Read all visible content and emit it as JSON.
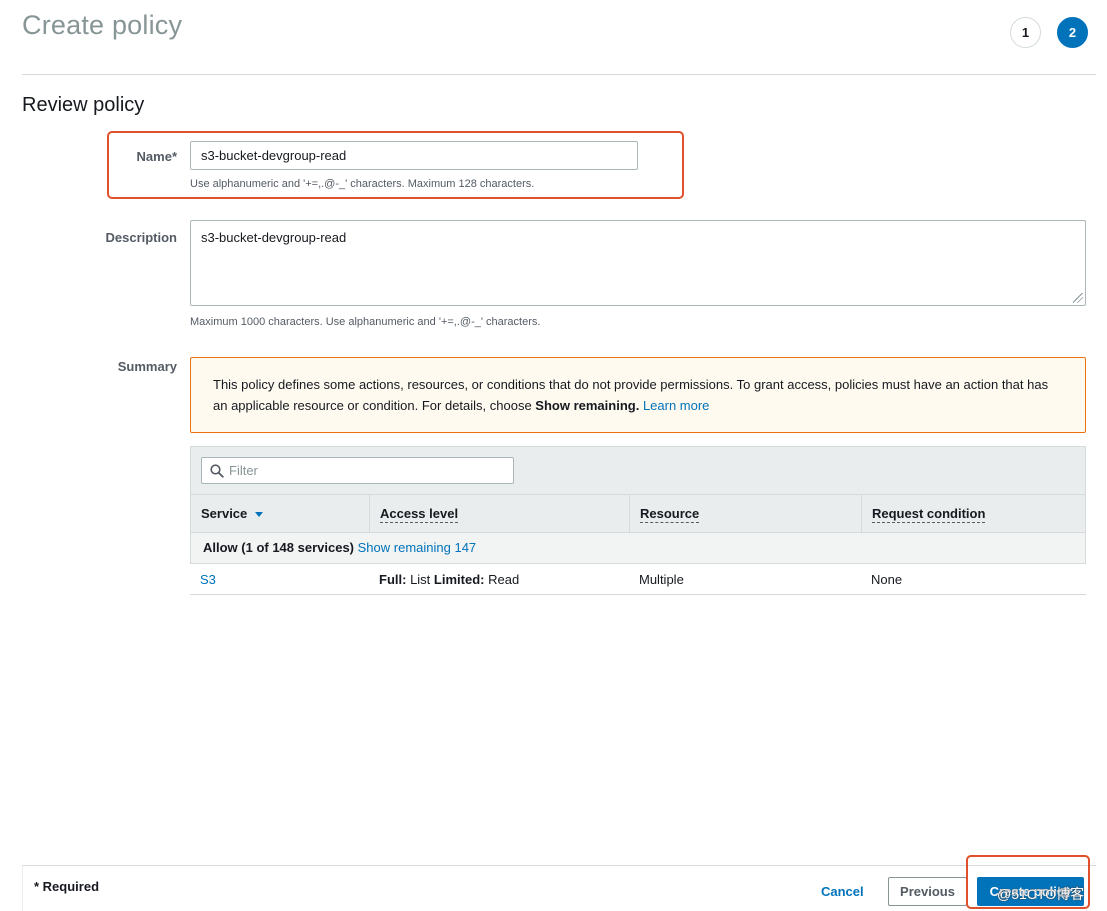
{
  "page": {
    "title": "Create policy"
  },
  "steps": [
    "1",
    "2"
  ],
  "section": {
    "title": "Review policy"
  },
  "form": {
    "name": {
      "label": "Name*",
      "value": "s3-bucket-devgroup-read",
      "hint": "Use alphanumeric and '+=,.@-_' characters. Maximum 128 characters."
    },
    "description": {
      "label": "Description",
      "value": "s3-bucket-devgroup-read",
      "hint": "Maximum 1000 characters. Use alphanumeric and '+=,.@-_' characters."
    }
  },
  "summary": {
    "label": "Summary",
    "warning": {
      "text_before": "This policy defines some actions, resources, or conditions that do not provide permissions. To grant access, policies must have an action that has an applicable resource or condition. For details, choose ",
      "bold": "Show remaining.",
      "link": "Learn more"
    },
    "filter_placeholder": "Filter",
    "columns": [
      "Service",
      "Access level",
      "Resource",
      "Request condition"
    ],
    "group": {
      "label": "Allow (1 of 148 services)",
      "link": "Show remaining 147"
    },
    "rows": [
      {
        "service": "S3",
        "access_full_label": "Full:",
        "access_full_value": "List",
        "access_limited_label": "Limited:",
        "access_limited_value": "Read",
        "resource": "Multiple",
        "condition": "None"
      }
    ]
  },
  "footer": {
    "required_note": "* Required",
    "cancel_label": "Cancel",
    "previous_label": "Previous",
    "create_label": "Create policy"
  },
  "watermark": "@51CTO博客",
  "colors": {
    "primary": "#0073bb",
    "highlight": "#e0502c",
    "warning_border": "#ec7211"
  }
}
